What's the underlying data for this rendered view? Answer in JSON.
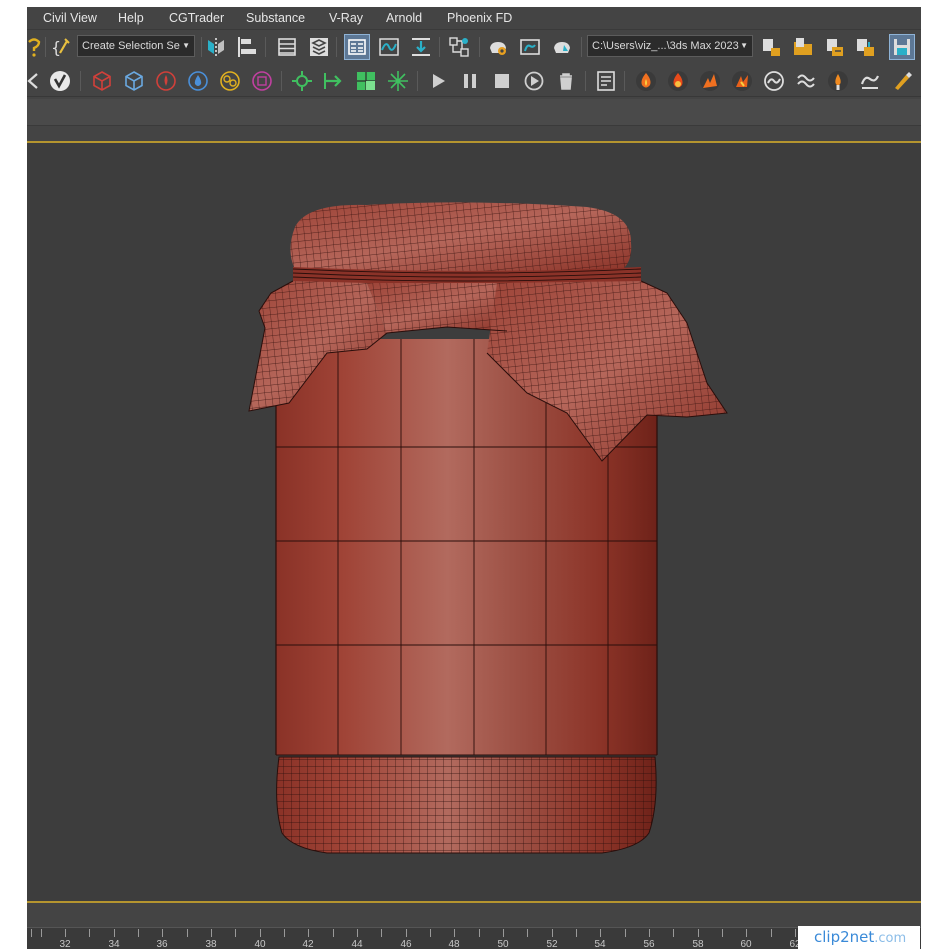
{
  "menu": {
    "items": [
      "Civil View",
      "Help",
      "CGTrader",
      "Substance",
      "V-Ray",
      "Arnold",
      "Phoenix FD"
    ]
  },
  "toolbar1": {
    "selection_set_dropdown": "Create Selection Se",
    "path_dropdown": "C:\\Users\\viz_...\\3ds Max 2023"
  },
  "timeline": {
    "ticks": [
      "32",
      "34",
      "36",
      "38",
      "40",
      "42",
      "44",
      "46",
      "48",
      "50",
      "52",
      "54",
      "56",
      "58",
      "60",
      "62"
    ]
  },
  "watermark": {
    "brand": "clip2net",
    "suffix": ".com"
  },
  "colors": {
    "ui_background": "#444444",
    "viewport_background": "#3d3d3d",
    "active_viewport_border": "#b5952f",
    "model_color": "#8f3a2f",
    "wireframe_color": "#2a0e0b"
  }
}
